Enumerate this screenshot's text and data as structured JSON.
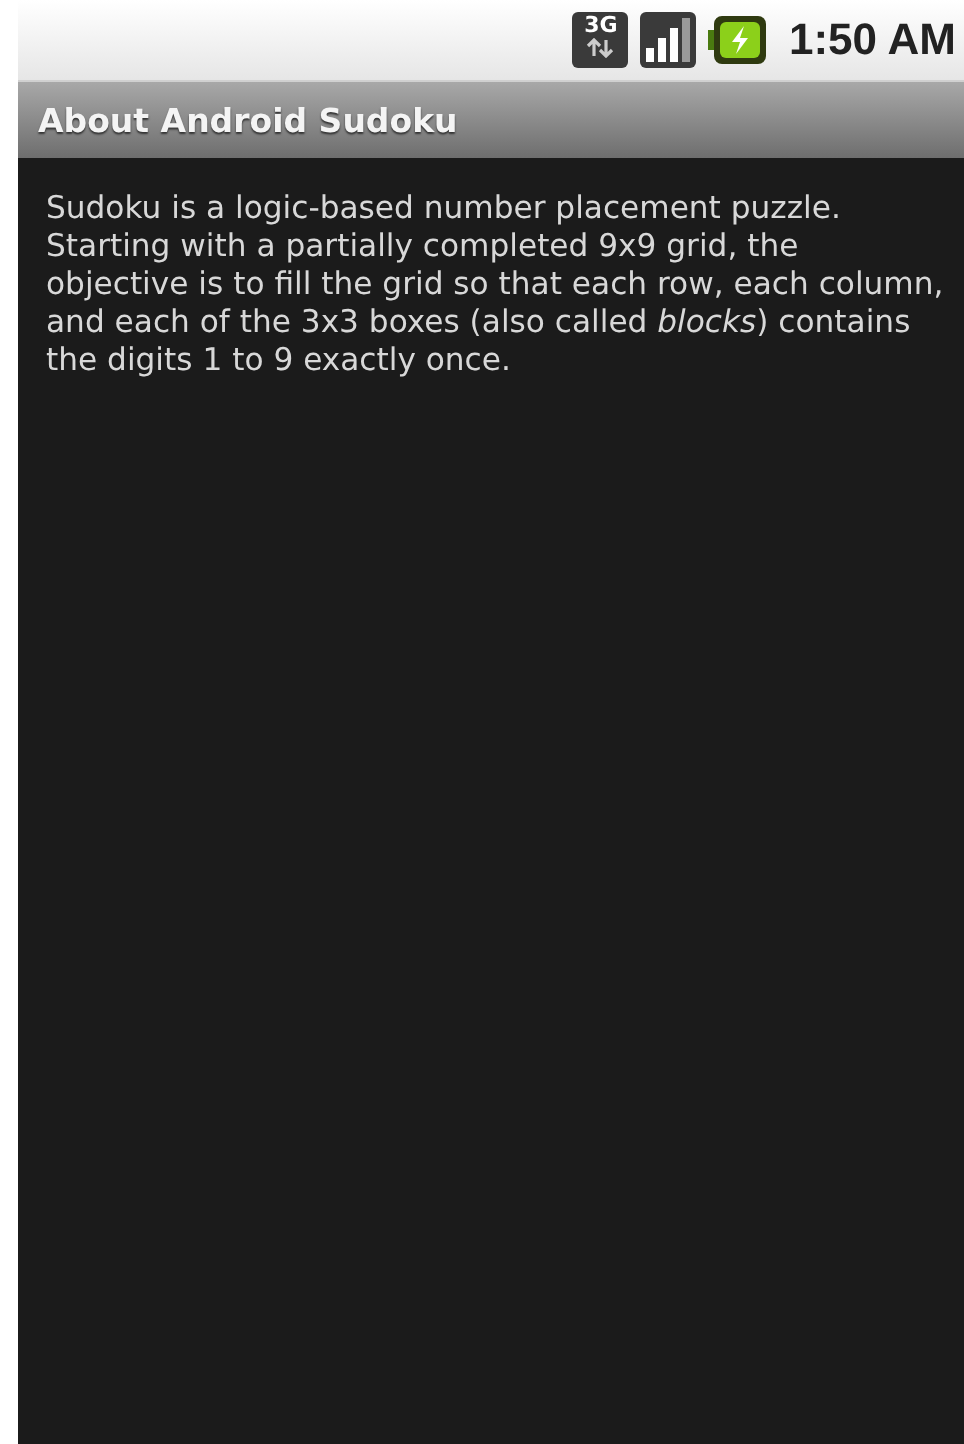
{
  "status_bar": {
    "network_label": "3G",
    "time": "1:50 AM"
  },
  "window": {
    "title": "About Android Sudoku"
  },
  "content": {
    "text": "Sudoku is a logic-based number placement puzzle. Starting with a partially completed 9x9 grid, the objective is to fill the grid so that each row, each column, and each of the 3x3 boxes (also called *blocks*) contains the digits 1 to 9 exactly once."
  }
}
